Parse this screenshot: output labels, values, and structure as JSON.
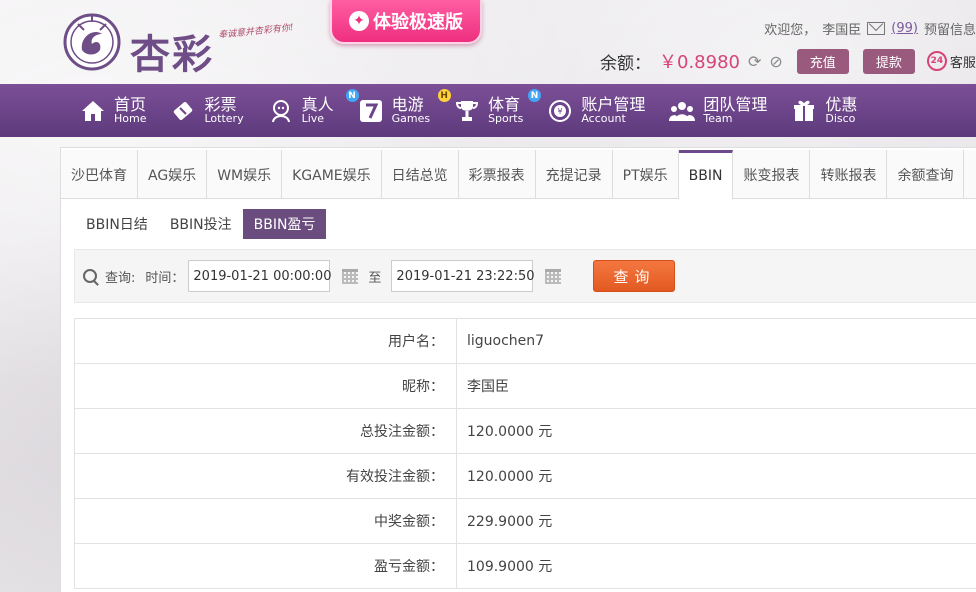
{
  "header": {
    "logo_text": "杏彩",
    "slogan": "奉诚意并杏彩有你!",
    "promo_label": "体验极速版",
    "greeting": "欢迎您，",
    "username": "李国臣",
    "mail_count": "(99)",
    "extra_link": "预留信息",
    "balance_label": "余额：",
    "balance_value": "￥0.8980",
    "recharge_label": "充值",
    "withdraw_label": "提款",
    "service_label": "客服"
  },
  "nav": {
    "items": [
      {
        "cn": "首页",
        "en": "Home",
        "icon": "home-icon",
        "badge": ""
      },
      {
        "cn": "彩票",
        "en": "Lottery",
        "icon": "ticket-icon",
        "badge": ""
      },
      {
        "cn": "真人",
        "en": "Live",
        "icon": "dealer-icon",
        "badge": "N"
      },
      {
        "cn": "电游",
        "en": "Games",
        "icon": "slot-seven-icon",
        "badge": "H"
      },
      {
        "cn": "体育",
        "en": "Sports",
        "icon": "trophy-icon",
        "badge": "N"
      },
      {
        "cn": "账户管理",
        "en": "Account",
        "icon": "account-icon",
        "badge": ""
      },
      {
        "cn": "团队管理",
        "en": "Team",
        "icon": "team-icon",
        "badge": ""
      },
      {
        "cn": "优惠",
        "en": "Disco",
        "icon": "gift-icon",
        "badge": ""
      }
    ]
  },
  "tabs": [
    "沙巴体育",
    "AG娱乐",
    "WM娱乐",
    "KGAME娱乐",
    "日结总览",
    "彩票报表",
    "充提记录",
    "PT娱乐",
    "BBIN",
    "账变报表",
    "转账报表",
    "余额查询"
  ],
  "active_tab": "BBIN",
  "subtabs": [
    "BBIN日结",
    "BBIN投注",
    "BBIN盈亏"
  ],
  "active_subtab": "BBIN盈亏",
  "query": {
    "query_label": "查询:",
    "time_label": "时间：",
    "start_time": "2019-01-21 00:00:00",
    "to_label": "至",
    "end_time": "2019-01-21 23:22:50",
    "search_button": "查询"
  },
  "details": [
    {
      "label": "用户名：",
      "value": "liguochen7"
    },
    {
      "label": "昵称：",
      "value": "李国臣"
    },
    {
      "label": "总投注金额：",
      "value": "120.0000 元"
    },
    {
      "label": "有效投注金额：",
      "value": "120.0000 元"
    },
    {
      "label": "中奖金额：",
      "value": "229.9000 元"
    },
    {
      "label": "盈亏金额：",
      "value": "109.9000 元"
    }
  ],
  "colors": {
    "nav_purple": "#6b4589",
    "accent_pink": "#d64478",
    "search_orange": "#e8652e",
    "subtab_active": "#6a4c7e"
  }
}
